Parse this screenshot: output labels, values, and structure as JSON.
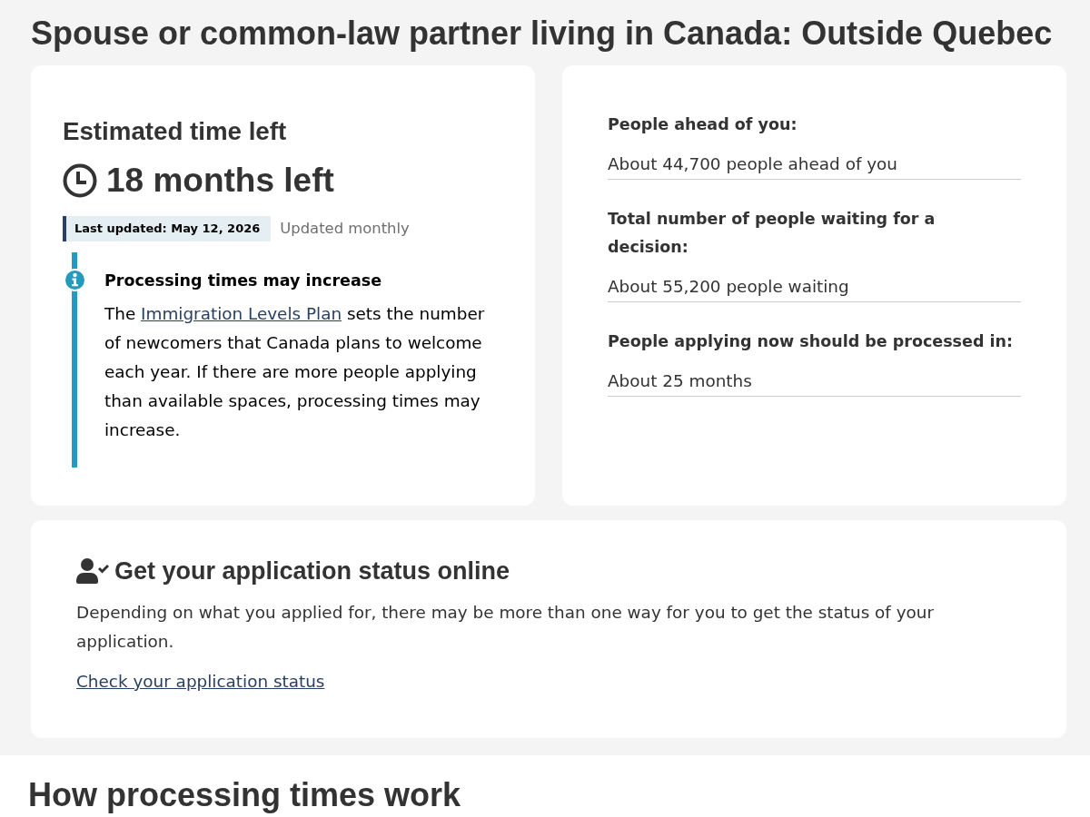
{
  "page_title": "Spouse or common-law partner living in Canada: Outside Quebec",
  "estimate": {
    "heading": "Estimated time left",
    "time_left": "18 months left",
    "last_updated": "Last updated: May 12, 2026",
    "update_frequency": "Updated monthly",
    "notice": {
      "title": "Processing times may increase",
      "text_before": "The ",
      "link": "Immigration Levels Plan",
      "text_after": " sets the number of newcomers that Canada plans to welcome each year. If there are more people applying than available spaces, processing times may increase."
    }
  },
  "stats": [
    {
      "label": "People ahead of you:",
      "value": "About 44,700 people ahead of you"
    },
    {
      "label": "Total number of people waiting for a decision:",
      "value": "About 55,200 people waiting"
    },
    {
      "label": "People applying now should be processed in:",
      "value": "About 25 months"
    }
  ],
  "status": {
    "heading": "Get your application status online",
    "text": "Depending on what you applied for, there may be more than one way for you to get the status of your application.",
    "link": "Check your application status"
  },
  "section_heading": "How processing times work"
}
